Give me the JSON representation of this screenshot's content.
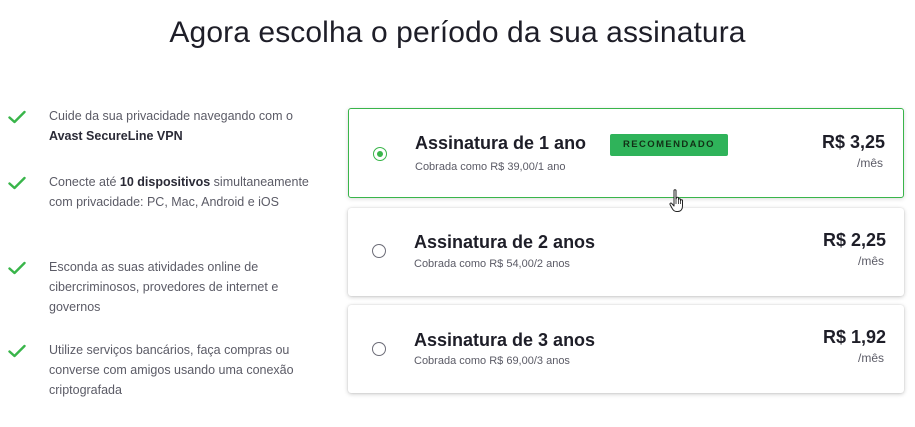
{
  "header": {
    "title": "Agora escolha o período da sua assinatura"
  },
  "features": [
    {
      "pre": "Cuide da sua privacidade navegando com o ",
      "bold": "Avast SecureLine VPN",
      "post": ""
    },
    {
      "pre": "Conecte até ",
      "bold": "10 dispositivos",
      "post": " simultaneamente com privacidade: PC, Mac, Android e iOS"
    },
    {
      "pre": "Esconda as suas atividades online de cibercriminosos, provedores de internet e governos",
      "bold": "",
      "post": ""
    },
    {
      "pre": "Utilize serviços bancários, faça compras ou converse com amigos usando uma conexão criptografada",
      "bold": "",
      "post": ""
    }
  ],
  "plans": [
    {
      "name": "Assinatura de 1 ano",
      "billing": "Cobrada como R$ 39,00/1 ano",
      "price": "R$ 3,25",
      "per": "/mês",
      "badge": "RECOMENDADO",
      "selected": true
    },
    {
      "name": "Assinatura de 2 anos",
      "billing": "Cobrada como R$ 54,00/2 anos",
      "price": "R$ 2,25",
      "per": "/mês",
      "selected": false
    },
    {
      "name": "Assinatura de 3 anos",
      "billing": "Cobrada como R$ 69,00/3 anos",
      "price": "R$ 1,92",
      "per": "/mês",
      "selected": false
    }
  ],
  "colors": {
    "accent": "#39b54a",
    "badge_bg": "#2fb35a",
    "text": "#1e1e28",
    "muted": "#5b5b66"
  },
  "icons": {
    "feature": "check-icon",
    "cursor": "hand-pointer-icon"
  }
}
